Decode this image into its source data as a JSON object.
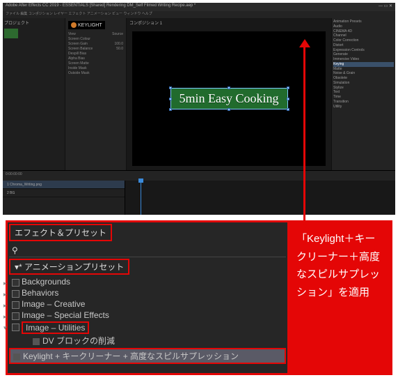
{
  "window": {
    "title": "Adobe After Effects CC 2019 - ESSENTIALS [Shared] Rendering DM_Self Filmed Writing Recipe.aep *"
  },
  "menubar": "ファイル 編集 コンポジション レイヤー エフェクト アニメーション ビュー ウィンドウ ヘルプ",
  "project": {
    "header": "プロジェクト"
  },
  "effects": {
    "badge": "KEYLIGHT",
    "rows": [
      "View",
      "Source",
      "Screen Colour",
      "",
      "Screen Gain",
      "100.0",
      "Screen Balance",
      "50.0",
      "Despill Bias",
      "",
      "Alpha Bias",
      "",
      "Screen Matte",
      "",
      "Inside Mask",
      "",
      "Outside Mask",
      ""
    ]
  },
  "comp": {
    "tab": "コンポジション 1"
  },
  "viewer": {
    "title_text": "5min Easy Cooking"
  },
  "browser": {
    "items": [
      "Animation Presets",
      "Audio",
      "CINEMA 4D",
      "Channel",
      "Color Correction",
      "Distort",
      "Expression Controls",
      "Generate",
      "Immersive Video",
      "Keying",
      "Matte",
      "Noise & Grain",
      "Obsolete",
      "Simulation",
      "Stylize",
      "Text",
      "Time",
      "Transition",
      "Utility"
    ],
    "selected": "Keying"
  },
  "timeline": {
    "header": "0:00:00:00",
    "layer1": "1  Chroma_Writing.png",
    "layer2": "2  BG"
  },
  "anno": {
    "panel_title": "エフェクト＆プリセット",
    "search_icon": "⚲",
    "category": "▾* アニメーションプリセット",
    "folders": [
      "Backgrounds",
      "Behaviors",
      "Image – Creative",
      "Image – Special Effects"
    ],
    "open_folder": "Image – Utilities",
    "sub1": "DV ブロックの削減",
    "sub2": "Keylight + キークリーナー + 高度なスピルサプレッション"
  },
  "callout": {
    "text": "「Keylight＋キークリーナー＋高度なスピルサプレッション」を適用"
  }
}
